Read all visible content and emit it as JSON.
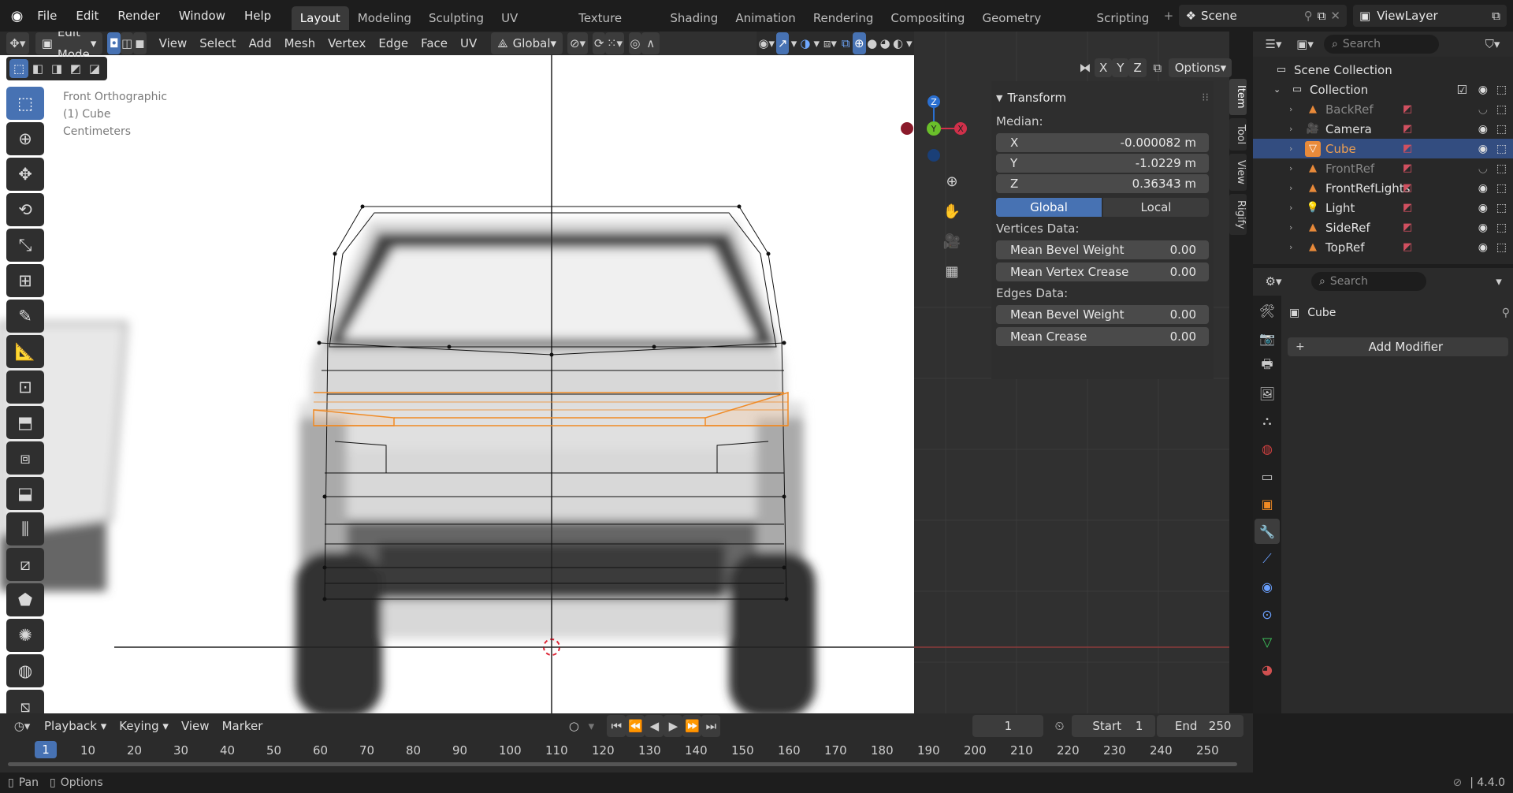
{
  "app": {
    "version": "4.4.0"
  },
  "menu": [
    "File",
    "Edit",
    "Render",
    "Window",
    "Help"
  ],
  "workspaces": [
    "Layout",
    "Modeling",
    "Sculpting",
    "UV Editing",
    "Texture Paint",
    "Shading",
    "Animation",
    "Rendering",
    "Compositing",
    "Geometry Nodes",
    "Scripting"
  ],
  "active_workspace": "Layout",
  "scene": {
    "name": "Scene",
    "view_layer": "ViewLayer"
  },
  "viewport_header": {
    "mode": "Edit Mode",
    "menus": [
      "View",
      "Select",
      "Add",
      "Mesh",
      "Vertex",
      "Edge",
      "Face",
      "UV"
    ],
    "orientation": "Global",
    "axes": [
      "X",
      "Y",
      "Z"
    ],
    "options": "Options"
  },
  "viewport": {
    "view_name": "Front Orthographic",
    "object_label": "(1) Cube",
    "units": "Centimeters"
  },
  "gizmo": {
    "z": "Z",
    "y": "Y",
    "x": "X"
  },
  "npanel": {
    "tabs": [
      "Item",
      "Tool",
      "View",
      "Rigify"
    ],
    "section": "Transform",
    "median_label": "Median:",
    "x_label": "X",
    "x_value": "-0.000082 m",
    "y_label": "Y",
    "y_value": "-1.0229 m",
    "z_label": "Z",
    "z_value": "0.36343 m",
    "global": "Global",
    "local": "Local",
    "vertices_data": "Vertices Data:",
    "mean_bevel_weight": "Mean Bevel Weight",
    "mean_bevel_weight_v": "0.00",
    "mean_vertex_crease": "Mean Vertex Crease",
    "mean_vertex_crease_v": "0.00",
    "edges_data": "Edges Data:",
    "edge_bevel_weight": "Mean Bevel Weight",
    "edge_bevel_weight_v": "0.00",
    "mean_crease": "Mean Crease",
    "mean_crease_v": "0.00"
  },
  "outliner": {
    "search_placeholder": "Search",
    "scene_collection": "Scene Collection",
    "collection": "Collection",
    "items": [
      {
        "name": "BackRef",
        "dim": true,
        "selected": false
      },
      {
        "name": "Camera",
        "dim": false,
        "selected": false
      },
      {
        "name": "Cube",
        "dim": false,
        "selected": true
      },
      {
        "name": "FrontRef",
        "dim": true,
        "selected": false
      },
      {
        "name": "FrontRefLights",
        "dim": false,
        "selected": false
      },
      {
        "name": "Light",
        "dim": false,
        "selected": false
      },
      {
        "name": "SideRef",
        "dim": false,
        "selected": false
      },
      {
        "name": "TopRef",
        "dim": false,
        "selected": false
      }
    ]
  },
  "properties": {
    "search_placeholder": "Search",
    "object_name": "Cube",
    "add_modifier": "Add Modifier"
  },
  "timeline": {
    "menus": [
      "Playback",
      "Keying",
      "View",
      "Marker"
    ],
    "current_frame": "1",
    "start_label": "Start",
    "start": "1",
    "end_label": "End",
    "end": "250",
    "ruler": [
      "10",
      "20",
      "30",
      "40",
      "50",
      "60",
      "70",
      "80",
      "90",
      "100",
      "110",
      "120",
      "130",
      "140",
      "150",
      "160",
      "170",
      "180",
      "190",
      "200",
      "210",
      "220",
      "230",
      "240",
      "250"
    ]
  },
  "status": {
    "pan": "Pan",
    "options": "Options",
    "version": "4.4.0"
  }
}
